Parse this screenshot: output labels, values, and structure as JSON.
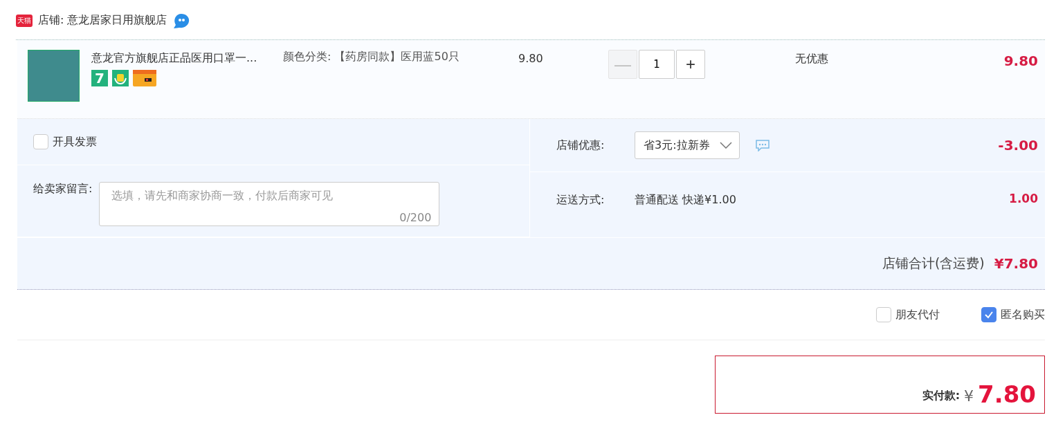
{
  "shop": {
    "badge": "天猫",
    "label": "店铺: 意龙居家日用旗舰店"
  },
  "item": {
    "title": "意龙官方旗舰店正品医用口罩一...",
    "sku": "颜色分类: 【药房同款】医用蓝50只",
    "price": "9.80",
    "minus": "—",
    "quantity": "1",
    "plus": "+",
    "minus_disabled": true,
    "promo": "无优惠",
    "subtotal": "9.80",
    "services": [
      {
        "kind": "return",
        "text": "7"
      },
      {
        "kind": "bag"
      },
      {
        "kind": "card"
      }
    ]
  },
  "invoice": {
    "label": "开具发票",
    "checked": false
  },
  "message": {
    "label": "给卖家留言:",
    "placeholder": "选填，请先和商家协商一致，付款后商家可见",
    "counter": "0/200"
  },
  "coupon": {
    "label": "店铺优惠:",
    "value": "省3元:拉新券",
    "amount": "-3.00"
  },
  "shipping": {
    "label": "运送方式:",
    "value": "普通配送 快递¥1.00",
    "amount": "1.00"
  },
  "total": {
    "label": "店铺合计(含运费)",
    "amount": "¥7.80"
  },
  "options": [
    {
      "label": "朋友代付",
      "checked": false
    },
    {
      "label": "匿名购买",
      "checked": true
    }
  ],
  "payment": {
    "label": "实付款:",
    "currency": "¥",
    "amount": "7.80"
  }
}
